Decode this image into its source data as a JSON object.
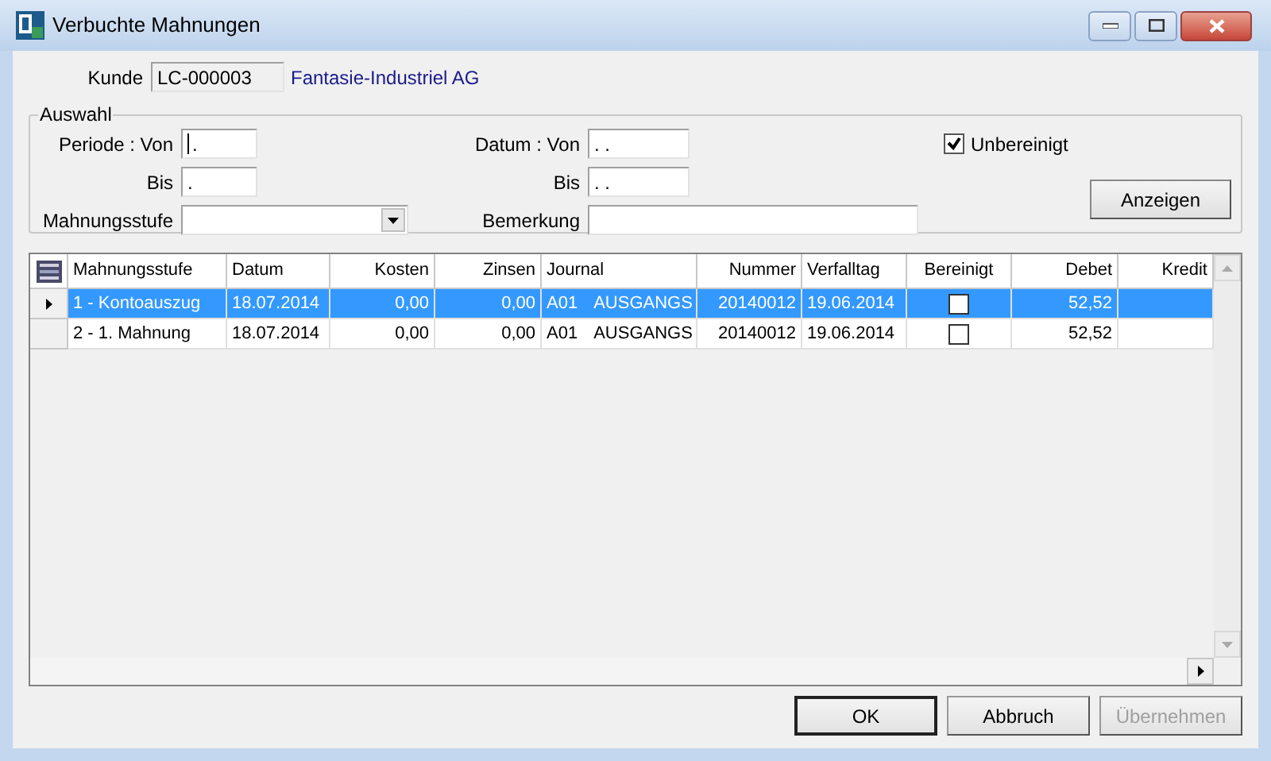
{
  "window": {
    "title": "Verbuchte Mahnungen"
  },
  "customer": {
    "label": "Kunde",
    "id": "LC-000003",
    "name": "Fantasie-Industriel AG"
  },
  "selection": {
    "title": "Auswahl",
    "left_fields": [
      {
        "label": "Periode : Von",
        "value": ".",
        "kind": "text",
        "focused": true
      },
      {
        "label": "Bis",
        "value": ".",
        "kind": "text",
        "focused": false
      },
      {
        "label": "Mahnungsstufe",
        "kind": "select",
        "focused": false
      }
    ],
    "right_fields": [
      {
        "label": "Datum : Von",
        "value": ". .",
        "kind": "text",
        "focused": false
      },
      {
        "label": "Bis",
        "value": ". .",
        "kind": "text",
        "focused": false
      },
      {
        "label": "Bemerkung",
        "kind": "wide",
        "focused": false
      }
    ],
    "unresolved": {
      "label": "Unbereinigt",
      "checked": true
    },
    "show_button": "Anzeigen"
  },
  "table": {
    "columns": [
      "Mahnungsstufe",
      "Datum",
      "Kosten",
      "Zinsen",
      "Journal",
      "Nummer",
      "Verfalltag",
      "Bereinigt",
      "Debet",
      "Kredit"
    ],
    "rows": [
      {
        "selected": true,
        "stufe": "1 - Kontoauszug",
        "datum": "18.07.2014",
        "kosten": "0,00",
        "zinsen": "0,00",
        "journal_code": "A01",
        "journal_name": "AUSGANGS",
        "nummer": "20140012",
        "verfalltag": "19.06.2014",
        "bereinigt": false,
        "debet": "52,52"
      },
      {
        "selected": false,
        "stufe": "2 - 1. Mahnung",
        "datum": "18.07.2014",
        "kosten": "0,00",
        "zinsen": "0,00",
        "journal_code": "A01",
        "journal_name": "AUSGANGS",
        "nummer": "20140012",
        "verfalltag": "19.06.2014",
        "bereinigt": false,
        "debet": "52,52"
      }
    ]
  },
  "buttons": [
    {
      "label": "OK",
      "default": true,
      "disabled": false
    },
    {
      "label": "Abbruch",
      "default": false,
      "disabled": false
    },
    {
      "label": "Übernehmen",
      "default": false,
      "disabled": true
    }
  ]
}
